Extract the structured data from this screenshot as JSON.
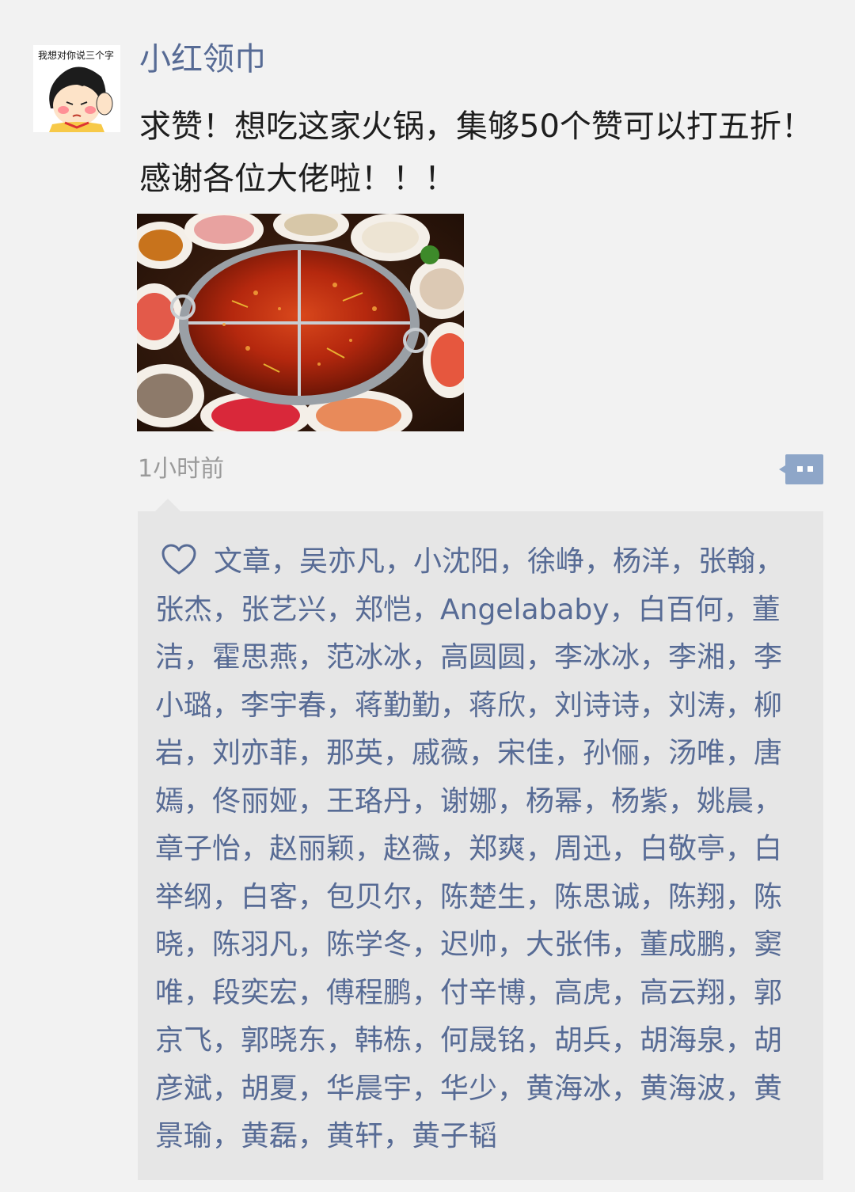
{
  "post": {
    "avatar_caption": "我想对你说三个字",
    "username": "小红领巾",
    "content": "求赞！想吃这家火锅，集够50个赞可以打五折！感谢各位大佬啦！！！",
    "timestamp": "1小时前"
  },
  "icons": {
    "heart": "heart-outline-icon",
    "comment": "comment-icon"
  },
  "colors": {
    "name": "#576b95",
    "likes_bg": "#e6e6e6",
    "page_bg": "#f2f2f2",
    "comment_button": "#8ea6c8"
  },
  "likes": {
    "text": "文章，吴亦凡，小沈阳，徐峥，杨洋，张翰，张杰，张艺兴，郑恺，Angelababy，白百何，董洁，霍思燕，范冰冰，高圆圆，李冰冰，李湘，李小璐，李宇春，蒋勤勤，蒋欣，刘诗诗，刘涛，柳岩，刘亦菲，那英，戚薇，宋佳，孙俪，汤唯，唐嫣，佟丽娅，王珞丹，谢娜，杨幂，杨紫，姚晨，章子怡，赵丽颖，赵薇，郑爽，周迅，白敬亭，白举纲，白客，包贝尔，陈楚生，陈思诚，陈翔，陈晓，陈羽凡，陈学冬，迟帅，大张伟，董成鹏，窦唯，段奕宏，傅程鹏，付辛博，高虎，高云翔，郭京飞，郭晓东，韩栋，何晟铭，胡兵，胡海泉，胡彦斌，胡夏，华晨宇，华少，黄海冰，黄海波，黄景瑜，黄磊，黄轩，黄子韬"
  }
}
